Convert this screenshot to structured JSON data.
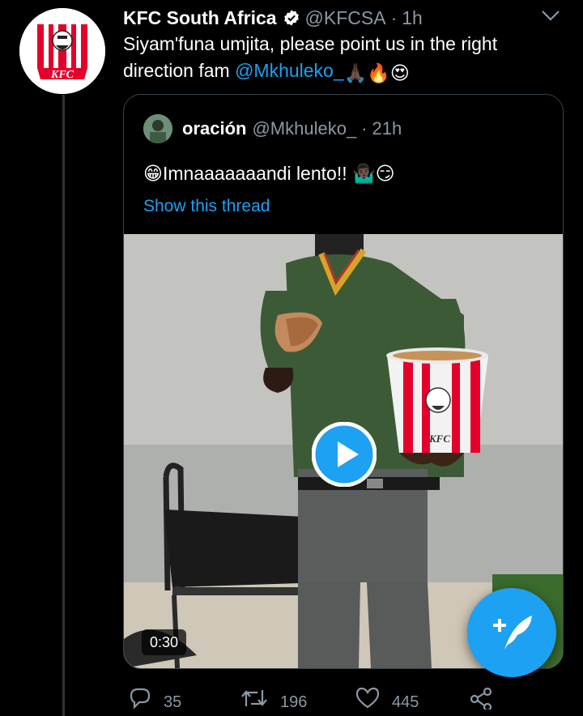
{
  "tweet": {
    "display_name": "KFC South Africa",
    "handle": "@KFCSA",
    "separator": "·",
    "time": "1h",
    "text_before": "Siyam'funa umjita, please point us in the right direction fam ",
    "mention": "@Mkhuleko_",
    "emojis": "🙏🏿🔥😍",
    "avatar_logo_text": "KFC"
  },
  "quote": {
    "display_name": "oración",
    "handle": "@Mkhuleko_",
    "separator": "·",
    "time": "21h",
    "text": "😁Imnaaaaaaandi lento!! 🤷🏿‍♂️😏",
    "thread_link": "Show this thread",
    "video_duration": "0:30",
    "bucket_logo_text": "KFC"
  },
  "actions": {
    "replies": "35",
    "retweets": "196",
    "likes": "445"
  },
  "colors": {
    "accent": "#1da1f2",
    "secondary_text": "#8b98a5",
    "border": "#38444d",
    "background": "#000000",
    "kfc_red": "#e4002b"
  },
  "icons": [
    "verified-icon",
    "chevron-down-icon",
    "play-icon",
    "compose-tweet-icon",
    "reply-icon",
    "retweet-icon",
    "like-icon",
    "share-icon"
  ]
}
